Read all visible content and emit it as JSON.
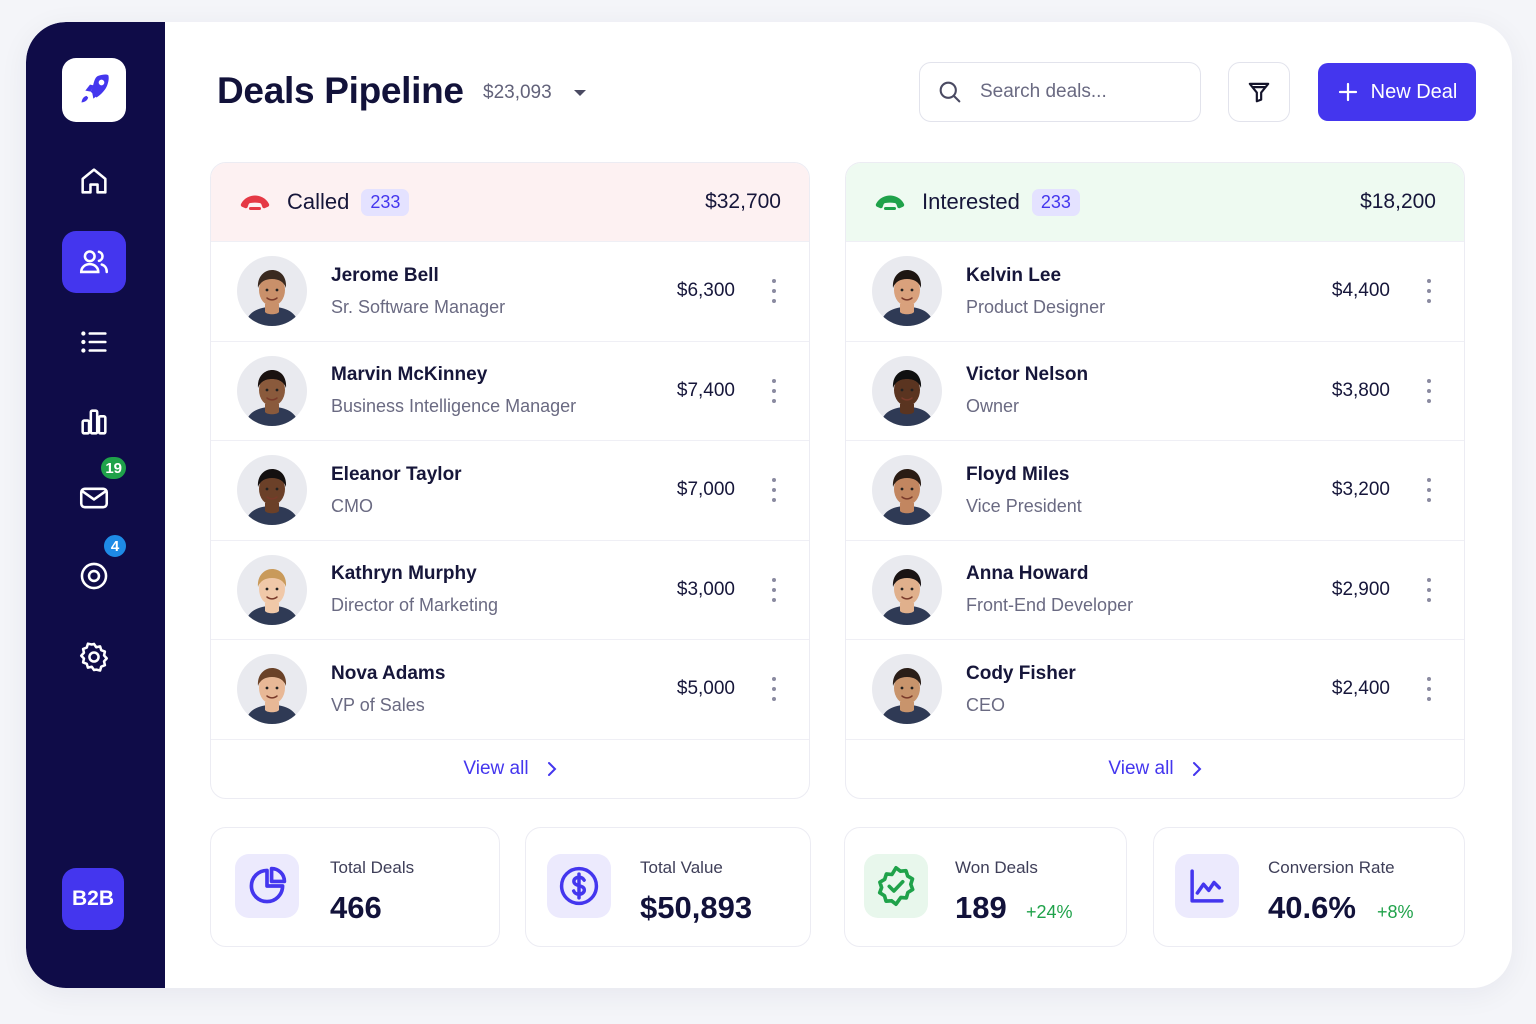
{
  "header": {
    "title": "Deals Pipeline",
    "total_value": "$23,093",
    "search_placeholder": "Search deals...",
    "new_deal_label": "New Deal"
  },
  "sidebar": {
    "items": [
      {
        "icon": "home-icon"
      },
      {
        "icon": "users-icon",
        "active": true
      },
      {
        "icon": "list-icon"
      },
      {
        "icon": "bar-chart-icon"
      },
      {
        "icon": "mail-icon",
        "badge": "19",
        "badge_color": "#1fa24a"
      },
      {
        "icon": "target-icon",
        "badge": "4",
        "badge_color": "#1e8be6"
      },
      {
        "icon": "gear-icon"
      }
    ],
    "footer_label": "B2B"
  },
  "columns": [
    {
      "title": "Called",
      "count": "233",
      "total": "$32,700",
      "accent": "#e53945",
      "header_bg": "#fdf1f2",
      "deals": [
        {
          "name": "Jerome Bell",
          "role": "Sr. Software Manager",
          "amount": "$6,300"
        },
        {
          "name": "Marvin McKinney",
          "role": "Business Intelligence Manager",
          "amount": "$7,400"
        },
        {
          "name": "Eleanor Taylor",
          "role": "CMO",
          "amount": "$7,000"
        },
        {
          "name": "Kathryn Murphy",
          "role": "Director of Marketing",
          "amount": "$3,000"
        },
        {
          "name": "Nova Adams",
          "role": "VP of Sales",
          "amount": "$5,000"
        }
      ],
      "view_all": "View all"
    },
    {
      "title": "Interested",
      "count": "233",
      "total": "$18,200",
      "accent": "#1fa24a",
      "header_bg": "#eefaf1",
      "deals": [
        {
          "name": "Kelvin Lee",
          "role": "Product Designer",
          "amount": "$4,400"
        },
        {
          "name": "Victor Nelson",
          "role": "Owner",
          "amount": "$3,800"
        },
        {
          "name": "Floyd Miles",
          "role": "Vice President",
          "amount": "$3,200"
        },
        {
          "name": "Anna Howard",
          "role": "Front-End Developer",
          "amount": "$2,900"
        },
        {
          "name": "Cody Fisher",
          "role": "CEO",
          "amount": "$2,400"
        }
      ],
      "view_all": "View all"
    }
  ],
  "stats": [
    {
      "label": "Total Deals",
      "value": "466",
      "delta": "",
      "icon": "pie-chart-icon"
    },
    {
      "label": "Total Value",
      "value": "$50,893",
      "delta": "",
      "icon": "dollar-icon"
    },
    {
      "label": "Won Deals",
      "value": "189",
      "delta": "+24%",
      "icon": "verified-badge-icon"
    },
    {
      "label": "Conversion Rate",
      "value": "40.6%",
      "delta": "+8%",
      "icon": "trend-line-icon"
    }
  ],
  "colors": {
    "accent": "#4436ee",
    "sidebar": "#0f0c48",
    "positive": "#1fa24a"
  }
}
